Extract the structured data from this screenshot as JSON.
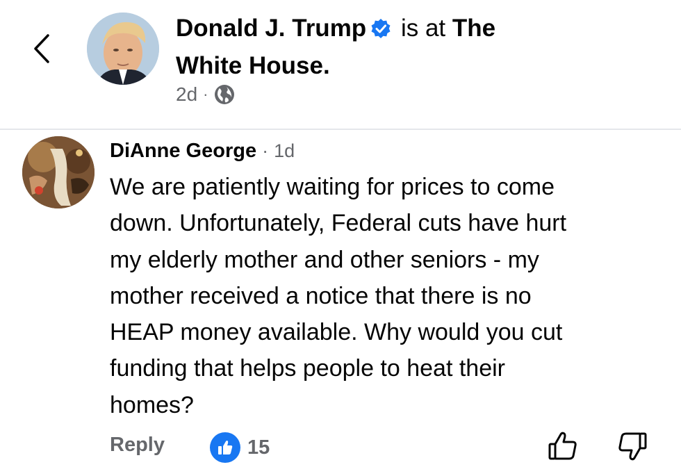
{
  "post": {
    "author": "Donald J. Trump",
    "verified": true,
    "action_text": "is at",
    "location_line1": "The",
    "location_line2": "White House.",
    "age": "2d",
    "separator": "·",
    "privacy_icon": "globe-icon"
  },
  "comment": {
    "author": "DiAnne George",
    "separator": "·",
    "age": "1d",
    "text": "We are patiently waiting for prices to come\ndown. Unfortunately, Federal cuts have hurt\nmy elderly mother and other seniors - my\nmother received a notice that there is no\nHEAP  money available. Why would you cut\nfunding that helps people to heat their\nhomes?",
    "reply_label": "Reply",
    "reaction_count": "15",
    "reaction_icon": "like-badge-icon"
  },
  "colors": {
    "accent": "#1877f2",
    "secondary_text": "#65676b",
    "divider": "#e4e6eb"
  }
}
